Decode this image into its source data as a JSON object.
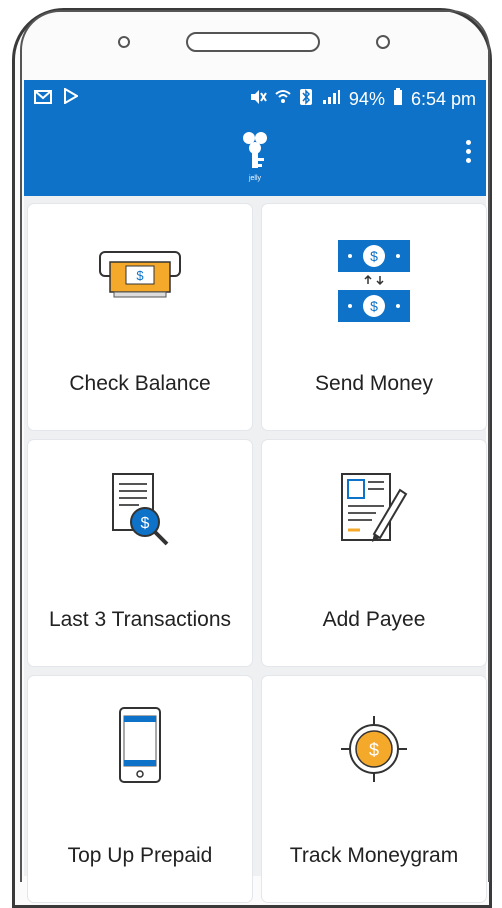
{
  "status_bar": {
    "left_icons": [
      "email-icon",
      "play-store-icon"
    ],
    "right_icons": [
      "mute-icon",
      "wifi-icon",
      "bluetooth-icon",
      "signal-icon"
    ],
    "battery": "94%",
    "time": "6:54 pm"
  },
  "app_bar": {
    "logo_text": "jelly",
    "menu_icon": "overflow-menu-icon"
  },
  "tiles": [
    {
      "label": "Check Balance",
      "icon": "atm-cash-icon"
    },
    {
      "label": "Send Money",
      "icon": "money-transfer-icon"
    },
    {
      "label": "Last 3 Transactions",
      "icon": "statement-search-icon"
    },
    {
      "label": "Add Payee",
      "icon": "form-edit-icon"
    },
    {
      "label": "Top Up Prepaid",
      "icon": "mobile-phone-icon"
    },
    {
      "label": "Track Moneygram",
      "icon": "target-coin-icon"
    }
  ],
  "colors": {
    "primary": "#0d72c8",
    "accent": "#f4a92b",
    "background": "#eef0f2"
  }
}
